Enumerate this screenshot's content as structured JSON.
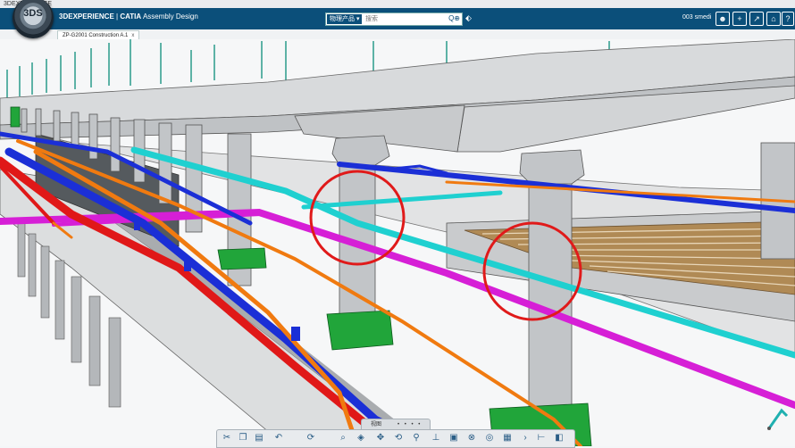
{
  "window": {
    "title": "3DEXPERIENCE"
  },
  "header": {
    "brand": "3DEXPERIENCE",
    "separator": " | ",
    "product": "CATIA",
    "app": "Assembly Design",
    "search_scope": "物理产品 ▾",
    "search_placeholder": "搜索",
    "user": "003 smedi",
    "colors": {
      "bar": "#0b4f7a",
      "accent": "#ffffff"
    }
  },
  "tabs": [
    {
      "label": "ZP-G2001 Construction A.1",
      "close": "x"
    }
  ],
  "annotations": {
    "highlight_color": "#e01a1a",
    "circle_count": 2
  },
  "scene": {
    "pipe_colors": {
      "magenta": "#d61fd6",
      "cyan": "#1fd0d0",
      "blue": "#1b2fd6",
      "red": "#e01818",
      "orange": "#f07a10",
      "green": "#1fa83a"
    }
  },
  "bottom_toolbar": {
    "pager_label": "视图",
    "pager_dots": "• • • •",
    "icons": [
      "cut-icon",
      "copy-icon",
      "paste-icon",
      "undo-icon",
      "update-icon",
      "zoom-icon",
      "cube-icon",
      "pan-icon",
      "rotate-icon",
      "search-part-icon",
      "compass-icon",
      "box-icon",
      "snap-icon",
      "camera-icon",
      "grid-icon",
      "arrow-icon",
      "tree-icon",
      "render-icon"
    ]
  }
}
